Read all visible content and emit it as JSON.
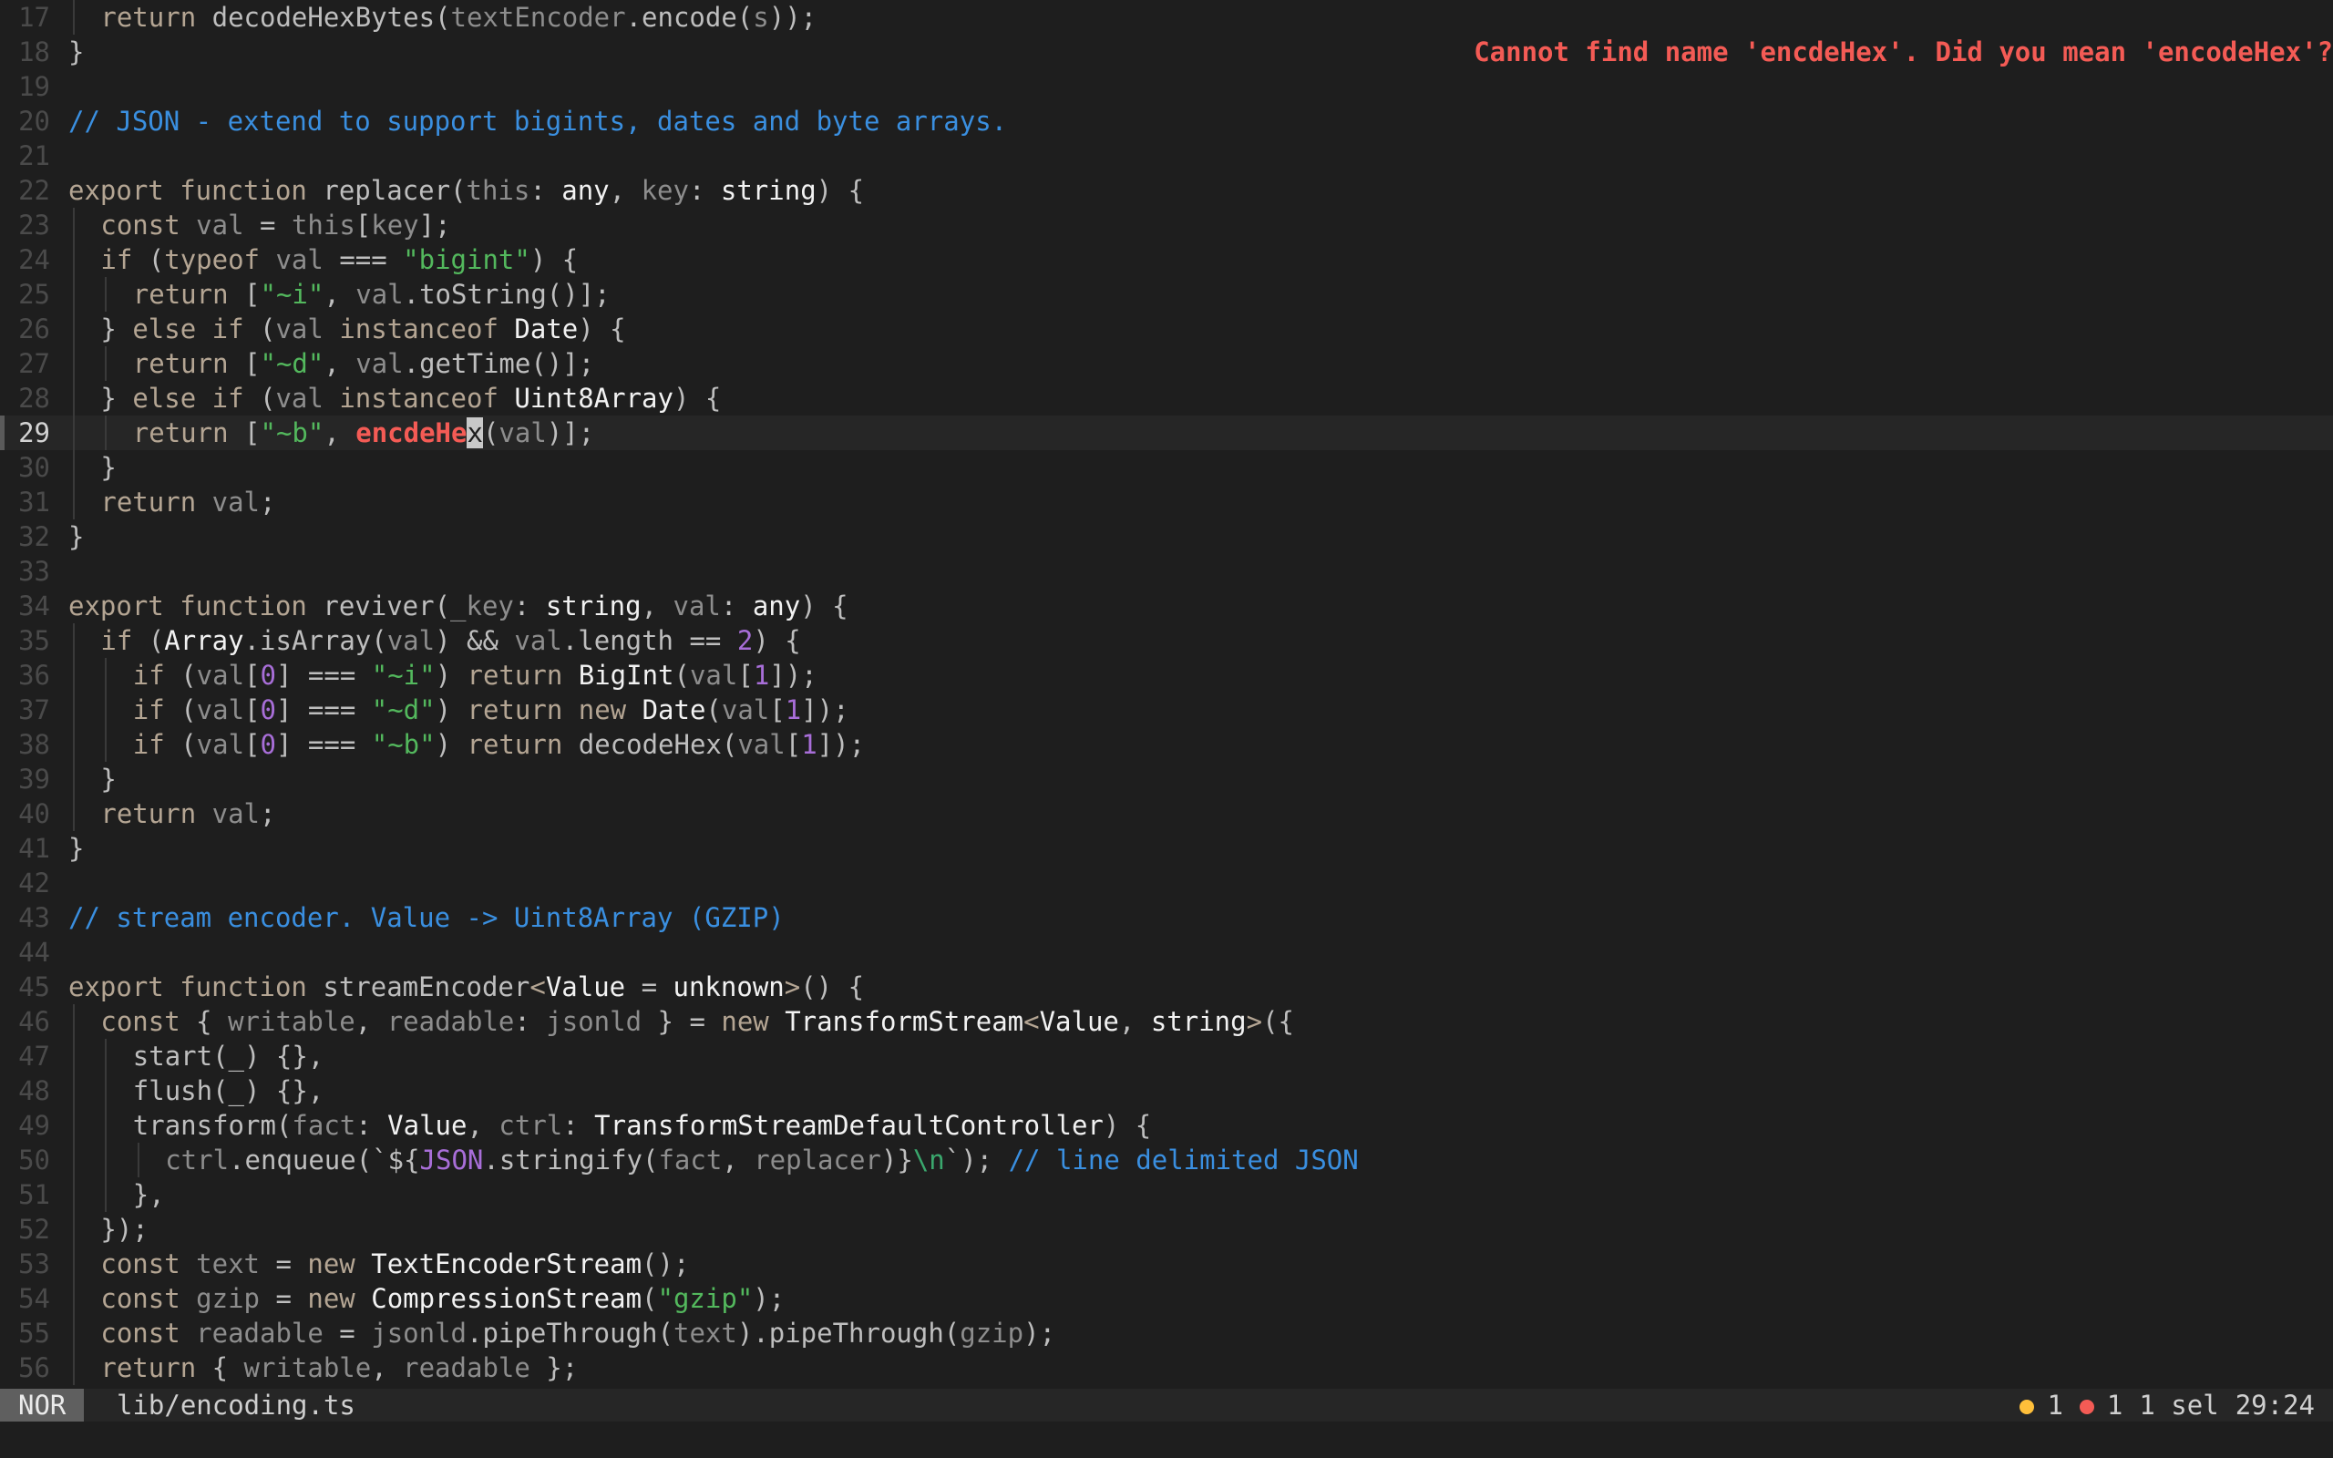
{
  "diagnostic": "Cannot find name 'encdeHex'. Did you mean 'encodeHex'?",
  "statusbar": {
    "mode": "NOR",
    "file": "lib/encoding.ts",
    "warnings": "1",
    "errors": "1",
    "selections": "1 sel",
    "position": "29:24"
  },
  "colors": {
    "background": "#1e1e1e",
    "error": "#f45b55",
    "warning": "#ffbf3a",
    "comment": "#3a8fe0",
    "string": "#53b85d"
  },
  "lines": [
    {
      "n": "17",
      "indent": 1,
      "seg": [
        [
          "kw",
          "return "
        ],
        [
          "fn",
          "decodeHexBytes("
        ],
        [
          "var",
          "textEncoder"
        ],
        [
          "fn",
          ".encode("
        ],
        [
          "var",
          "s"
        ],
        [
          "fn",
          "));"
        ]
      ]
    },
    {
      "n": "18",
      "indent": 0,
      "seg": [
        [
          "fn",
          "}"
        ]
      ],
      "diag": true
    },
    {
      "n": "19",
      "indent": 0,
      "seg": []
    },
    {
      "n": "20",
      "indent": 0,
      "seg": [
        [
          "com",
          "// JSON - extend to support bigints, dates and byte arrays."
        ]
      ]
    },
    {
      "n": "21",
      "indent": 0,
      "seg": []
    },
    {
      "n": "22",
      "indent": 0,
      "seg": [
        [
          "kw",
          "export function "
        ],
        [
          "fn",
          "replacer("
        ],
        [
          "var",
          "this"
        ],
        [
          "fn",
          ": "
        ],
        [
          "ty",
          "any"
        ],
        [
          "fn",
          ", "
        ],
        [
          "var",
          "key"
        ],
        [
          "fn",
          ": "
        ],
        [
          "ty",
          "string"
        ],
        [
          "fn",
          ") {"
        ]
      ]
    },
    {
      "n": "23",
      "indent": 1,
      "seg": [
        [
          "kw",
          "const "
        ],
        [
          "var",
          "val"
        ],
        [
          "fn",
          " = "
        ],
        [
          "var",
          "this"
        ],
        [
          "fn",
          "["
        ],
        [
          "var",
          "key"
        ],
        [
          "fn",
          "];"
        ]
      ]
    },
    {
      "n": "24",
      "indent": 1,
      "seg": [
        [
          "kw",
          "if "
        ],
        [
          "fn",
          "("
        ],
        [
          "kw",
          "typeof "
        ],
        [
          "var",
          "val"
        ],
        [
          "fn",
          " === "
        ],
        [
          "str",
          "\"bigint\""
        ],
        [
          "fn",
          ") {"
        ]
      ]
    },
    {
      "n": "25",
      "indent": 2,
      "seg": [
        [
          "kw",
          "return "
        ],
        [
          "fn",
          "["
        ],
        [
          "str",
          "\"~i\""
        ],
        [
          "fn",
          ", "
        ],
        [
          "var",
          "val"
        ],
        [
          "fn",
          ".toString()];"
        ]
      ]
    },
    {
      "n": "26",
      "indent": 1,
      "seg": [
        [
          "fn",
          "} "
        ],
        [
          "kw",
          "else if "
        ],
        [
          "fn",
          "("
        ],
        [
          "var",
          "val"
        ],
        [
          "kw",
          " instanceof "
        ],
        [
          "ty",
          "Date"
        ],
        [
          "fn",
          ") {"
        ]
      ]
    },
    {
      "n": "27",
      "indent": 2,
      "seg": [
        [
          "kw",
          "return "
        ],
        [
          "fn",
          "["
        ],
        [
          "str",
          "\"~d\""
        ],
        [
          "fn",
          ", "
        ],
        [
          "var",
          "val"
        ],
        [
          "fn",
          ".getTime()];"
        ]
      ]
    },
    {
      "n": "28",
      "indent": 1,
      "seg": [
        [
          "fn",
          "} "
        ],
        [
          "kw",
          "else if "
        ],
        [
          "fn",
          "("
        ],
        [
          "var",
          "val"
        ],
        [
          "kw",
          " instanceof "
        ],
        [
          "ty",
          "Uint8Array"
        ],
        [
          "fn",
          ") {"
        ]
      ]
    },
    {
      "n": "29",
      "indent": 2,
      "current": true,
      "seg": [
        [
          "kw",
          "return "
        ],
        [
          "fn",
          "["
        ],
        [
          "str",
          "\"~b\""
        ],
        [
          "fn",
          ", "
        ],
        [
          "err",
          "encdeHe"
        ],
        [
          "cur",
          "x"
        ],
        [
          "fn",
          "("
        ],
        [
          "var",
          "val"
        ],
        [
          "fn",
          ")];"
        ]
      ]
    },
    {
      "n": "30",
      "indent": 1,
      "seg": [
        [
          "fn",
          "}"
        ]
      ]
    },
    {
      "n": "31",
      "indent": 1,
      "seg": [
        [
          "kw",
          "return "
        ],
        [
          "var",
          "val"
        ],
        [
          "fn",
          ";"
        ]
      ]
    },
    {
      "n": "32",
      "indent": 0,
      "seg": [
        [
          "fn",
          "}"
        ]
      ]
    },
    {
      "n": "33",
      "indent": 0,
      "seg": []
    },
    {
      "n": "34",
      "indent": 0,
      "seg": [
        [
          "kw",
          "export function "
        ],
        [
          "fn",
          "reviver("
        ],
        [
          "var",
          "_key"
        ],
        [
          "fn",
          ": "
        ],
        [
          "ty",
          "string"
        ],
        [
          "fn",
          ", "
        ],
        [
          "var",
          "val"
        ],
        [
          "fn",
          ": "
        ],
        [
          "ty",
          "any"
        ],
        [
          "fn",
          ") {"
        ]
      ]
    },
    {
      "n": "35",
      "indent": 1,
      "seg": [
        [
          "kw",
          "if "
        ],
        [
          "fn",
          "("
        ],
        [
          "ty",
          "Array"
        ],
        [
          "fn",
          ".isArray("
        ],
        [
          "var",
          "val"
        ],
        [
          "fn",
          ") && "
        ],
        [
          "var",
          "val"
        ],
        [
          "fn",
          ".length == "
        ],
        [
          "num-lit",
          "2"
        ],
        [
          "fn",
          ") {"
        ]
      ]
    },
    {
      "n": "36",
      "indent": 2,
      "seg": [
        [
          "kw",
          "if "
        ],
        [
          "fn",
          "("
        ],
        [
          "var",
          "val"
        ],
        [
          "fn",
          "["
        ],
        [
          "num-lit",
          "0"
        ],
        [
          "fn",
          "] === "
        ],
        [
          "str",
          "\"~i\""
        ],
        [
          "fn",
          ") "
        ],
        [
          "kw",
          "return "
        ],
        [
          "ty",
          "BigInt"
        ],
        [
          "fn",
          "("
        ],
        [
          "var",
          "val"
        ],
        [
          "fn",
          "["
        ],
        [
          "num-lit",
          "1"
        ],
        [
          "fn",
          "]);"
        ]
      ]
    },
    {
      "n": "37",
      "indent": 2,
      "seg": [
        [
          "kw",
          "if "
        ],
        [
          "fn",
          "("
        ],
        [
          "var",
          "val"
        ],
        [
          "fn",
          "["
        ],
        [
          "num-lit",
          "0"
        ],
        [
          "fn",
          "] === "
        ],
        [
          "str",
          "\"~d\""
        ],
        [
          "fn",
          ") "
        ],
        [
          "kw",
          "return new "
        ],
        [
          "ty",
          "Date"
        ],
        [
          "fn",
          "("
        ],
        [
          "var",
          "val"
        ],
        [
          "fn",
          "["
        ],
        [
          "num-lit",
          "1"
        ],
        [
          "fn",
          "]);"
        ]
      ]
    },
    {
      "n": "38",
      "indent": 2,
      "seg": [
        [
          "kw",
          "if "
        ],
        [
          "fn",
          "("
        ],
        [
          "var",
          "val"
        ],
        [
          "fn",
          "["
        ],
        [
          "num-lit",
          "0"
        ],
        [
          "fn",
          "] === "
        ],
        [
          "str",
          "\"~b\""
        ],
        [
          "fn",
          ") "
        ],
        [
          "kw",
          "return "
        ],
        [
          "fn",
          "decodeHex("
        ],
        [
          "var",
          "val"
        ],
        [
          "fn",
          "["
        ],
        [
          "num-lit",
          "1"
        ],
        [
          "fn",
          "]);"
        ]
      ]
    },
    {
      "n": "39",
      "indent": 1,
      "seg": [
        [
          "fn",
          "}"
        ]
      ]
    },
    {
      "n": "40",
      "indent": 1,
      "seg": [
        [
          "kw",
          "return "
        ],
        [
          "var",
          "val"
        ],
        [
          "fn",
          ";"
        ]
      ]
    },
    {
      "n": "41",
      "indent": 0,
      "seg": [
        [
          "fn",
          "}"
        ]
      ]
    },
    {
      "n": "42",
      "indent": 0,
      "seg": []
    },
    {
      "n": "43",
      "indent": 0,
      "seg": [
        [
          "com",
          "// stream encoder. Value -> Uint8Array (GZIP)"
        ]
      ]
    },
    {
      "n": "44",
      "indent": 0,
      "seg": []
    },
    {
      "n": "45",
      "indent": 0,
      "seg": [
        [
          "kw",
          "export function "
        ],
        [
          "fn",
          "streamEncoder"
        ],
        [
          "kw",
          "<"
        ],
        [
          "ty",
          "Value"
        ],
        [
          "fn",
          " = "
        ],
        [
          "ty",
          "unknown"
        ],
        [
          "kw",
          ">"
        ],
        [
          "fn",
          "() {"
        ]
      ]
    },
    {
      "n": "46",
      "indent": 1,
      "seg": [
        [
          "kw",
          "const "
        ],
        [
          "fn",
          "{ "
        ],
        [
          "var",
          "writable"
        ],
        [
          "fn",
          ", "
        ],
        [
          "var",
          "readable"
        ],
        [
          "fn",
          ": "
        ],
        [
          "var",
          "jsonld"
        ],
        [
          "fn",
          " } = "
        ],
        [
          "kw",
          "new "
        ],
        [
          "ty",
          "TransformStream"
        ],
        [
          "kw",
          "<"
        ],
        [
          "ty",
          "Value"
        ],
        [
          "fn",
          ", "
        ],
        [
          "ty",
          "string"
        ],
        [
          "kw",
          ">"
        ],
        [
          "fn",
          "({"
        ]
      ]
    },
    {
      "n": "47",
      "indent": 2,
      "seg": [
        [
          "fn",
          "start(_) {},"
        ]
      ]
    },
    {
      "n": "48",
      "indent": 2,
      "seg": [
        [
          "fn",
          "flush(_) {},"
        ]
      ]
    },
    {
      "n": "49",
      "indent": 2,
      "seg": [
        [
          "fn",
          "transform("
        ],
        [
          "var",
          "fact"
        ],
        [
          "fn",
          ": "
        ],
        [
          "ty",
          "Value"
        ],
        [
          "fn",
          ", "
        ],
        [
          "var",
          "ctrl"
        ],
        [
          "fn",
          ": "
        ],
        [
          "ty",
          "TransformStreamDefaultController"
        ],
        [
          "fn",
          ") {"
        ]
      ]
    },
    {
      "n": "50",
      "indent": 3,
      "seg": [
        [
          "var",
          "ctrl"
        ],
        [
          "fn",
          ".enqueue(`${"
        ],
        [
          "num-lit",
          "JSON"
        ],
        [
          "fn",
          ".stringify("
        ],
        [
          "var",
          "fact"
        ],
        [
          "fn",
          ", "
        ],
        [
          "var",
          "replacer"
        ],
        [
          "fn",
          ")}"
        ],
        [
          "esc",
          "\\n"
        ],
        [
          "fn",
          "`); "
        ],
        [
          "com",
          "// line delimited JSON"
        ]
      ]
    },
    {
      "n": "51",
      "indent": 2,
      "seg": [
        [
          "fn",
          "},"
        ]
      ]
    },
    {
      "n": "52",
      "indent": 1,
      "seg": [
        [
          "fn",
          "});"
        ]
      ]
    },
    {
      "n": "53",
      "indent": 1,
      "seg": [
        [
          "kw",
          "const "
        ],
        [
          "var",
          "text"
        ],
        [
          "fn",
          " = "
        ],
        [
          "kw",
          "new "
        ],
        [
          "ty",
          "TextEncoderStream"
        ],
        [
          "fn",
          "();"
        ]
      ]
    },
    {
      "n": "54",
      "indent": 1,
      "seg": [
        [
          "kw",
          "const "
        ],
        [
          "var",
          "gzip"
        ],
        [
          "fn",
          " = "
        ],
        [
          "kw",
          "new "
        ],
        [
          "ty",
          "CompressionStream"
        ],
        [
          "fn",
          "("
        ],
        [
          "str",
          "\"gzip\""
        ],
        [
          "fn",
          ");"
        ]
      ]
    },
    {
      "n": "55",
      "indent": 1,
      "seg": [
        [
          "kw",
          "const "
        ],
        [
          "var",
          "readable"
        ],
        [
          "fn",
          " = "
        ],
        [
          "var",
          "jsonld"
        ],
        [
          "fn",
          ".pipeThrough("
        ],
        [
          "var",
          "text"
        ],
        [
          "fn",
          ").pipeThrough("
        ],
        [
          "var",
          "gzip"
        ],
        [
          "fn",
          ");"
        ]
      ]
    },
    {
      "n": "56",
      "indent": 1,
      "seg": [
        [
          "kw",
          "return "
        ],
        [
          "fn",
          "{ "
        ],
        [
          "var",
          "writable"
        ],
        [
          "fn",
          ", "
        ],
        [
          "var",
          "readable"
        ],
        [
          "fn",
          " };"
        ]
      ]
    }
  ]
}
